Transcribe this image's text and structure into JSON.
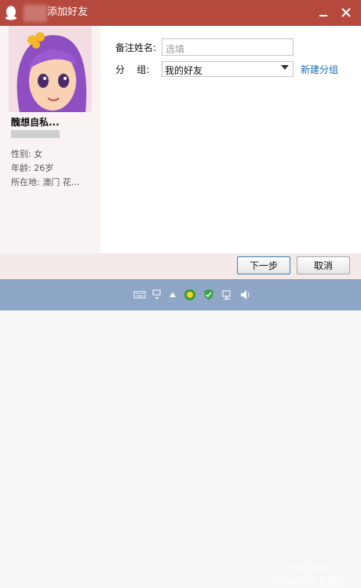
{
  "window": {
    "title": "添加好友"
  },
  "profile": {
    "nickname": "醜想自私...",
    "gender": "性别: 女",
    "age": "年龄: 26岁",
    "location": "所在地: 澳门  花..."
  },
  "form": {
    "remark_label": "备注姓名:",
    "remark_placeholder": "选填",
    "group_label": "分    组:",
    "group_value": "我的好友",
    "new_group_link": "新建分组"
  },
  "buttons": {
    "next": "下一步",
    "cancel": "取消"
  },
  "taskbar": {
    "time": "上午 10:47",
    "date": "2016/3/23 星期三",
    "icons": [
      "keyboard-icon",
      "input-method-icon",
      "up-arrow-icon",
      "qq-tray-icon",
      "shield-icon",
      "network-icon",
      "volume-icon"
    ]
  },
  "colors": {
    "titlebar": "#b6493e",
    "link": "#1a6eb2",
    "taskbar": "#8fa7c7"
  }
}
